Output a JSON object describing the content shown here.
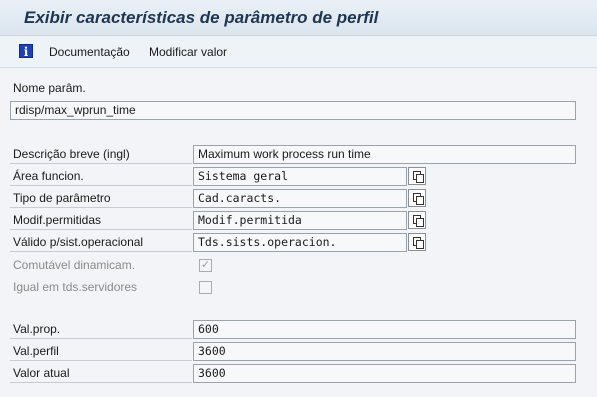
{
  "window": {
    "title": "Exibir características de parâmetro de perfil"
  },
  "toolbar": {
    "info_icon": "i",
    "documentation_label": "Documentação",
    "modify_value_label": "Modificar valor"
  },
  "param": {
    "name_label": "Nome parâm.",
    "name_value": "rdisp/max_wprun_time"
  },
  "fields": {
    "descricao_label": "Descrição breve (ingl)",
    "descricao_value": "Maximum work process run time",
    "area_label": "Área funcion.",
    "area_value": "Sistema geral",
    "tipo_label": "Tipo de parâmetro",
    "tipo_value": "Cad.caracts.",
    "modif_label": "Modif.permitidas",
    "modif_value": "Modif.permitida",
    "valido_label": "Válido p/sist.operacional",
    "valido_value": "Tds.sists.operacion.",
    "comutavel_label": "Comutável dinamicam.",
    "comutavel_checked": true,
    "igual_label": "Igual em tds.servidores",
    "igual_checked": false
  },
  "values": {
    "prop_label": "Val.prop.",
    "prop_value": "600",
    "perfil_label": "Val.perfil",
    "perfil_value": "3600",
    "atual_label": "Valor atual",
    "atual_value": "3600"
  },
  "colors": {
    "title_text": "#1f3550",
    "info_icon_bg": "#1b3fbf",
    "content_bg": "#f2f4f7"
  }
}
